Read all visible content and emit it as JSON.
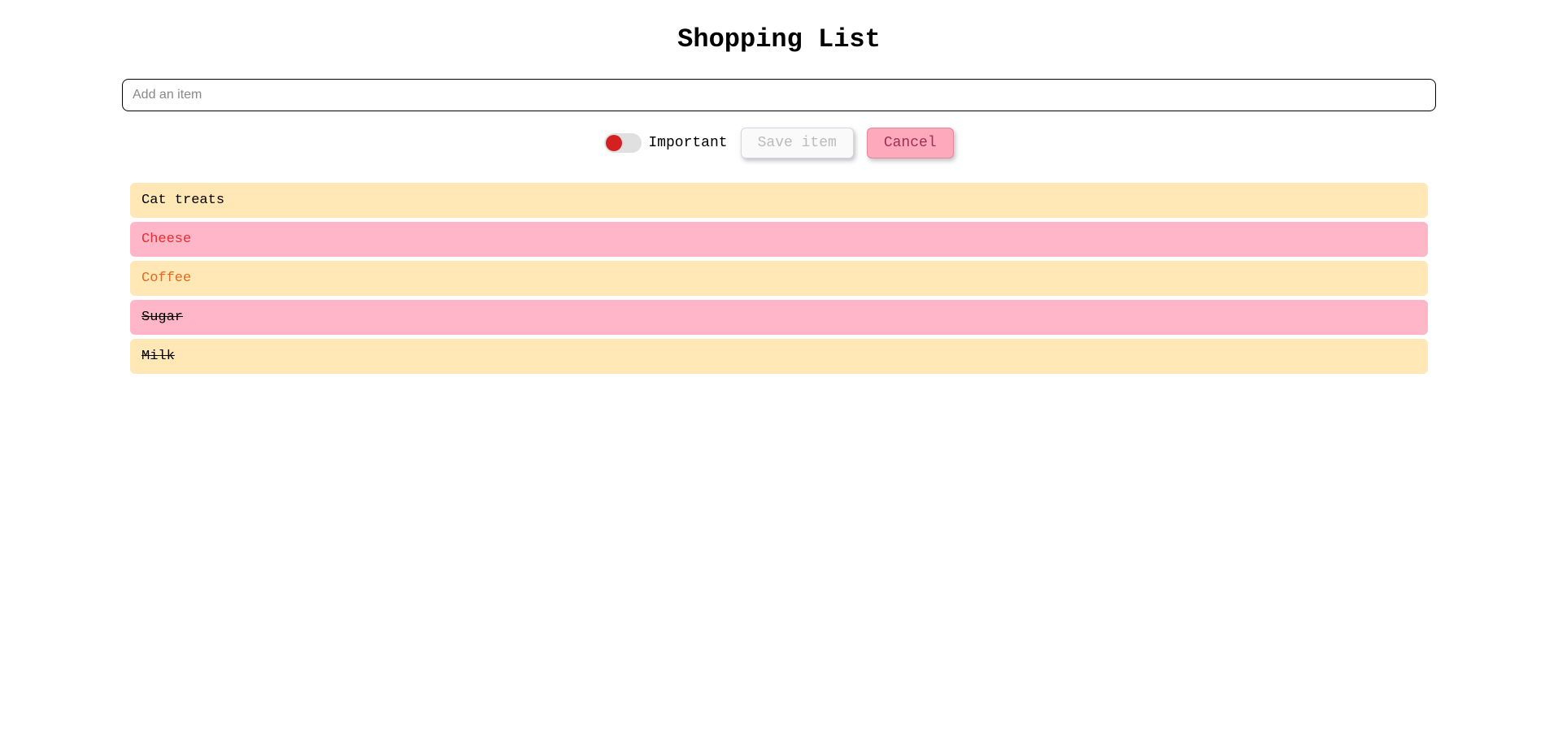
{
  "title": "Shopping List",
  "input": {
    "placeholder": "Add an item",
    "value": ""
  },
  "toggle": {
    "label": "Important",
    "on": false
  },
  "buttons": {
    "save": "Save item",
    "cancel": "Cancel"
  },
  "items": [
    {
      "text": "Cat treats",
      "bg": "yellow",
      "color": "normal",
      "strike": false
    },
    {
      "text": "Cheese",
      "bg": "pink",
      "color": "red",
      "strike": false
    },
    {
      "text": "Coffee",
      "bg": "yellow",
      "color": "orange",
      "strike": false
    },
    {
      "text": "Sugar",
      "bg": "pink",
      "color": "normal",
      "strike": true
    },
    {
      "text": "Milk",
      "bg": "yellow",
      "color": "normal",
      "strike": true
    }
  ]
}
